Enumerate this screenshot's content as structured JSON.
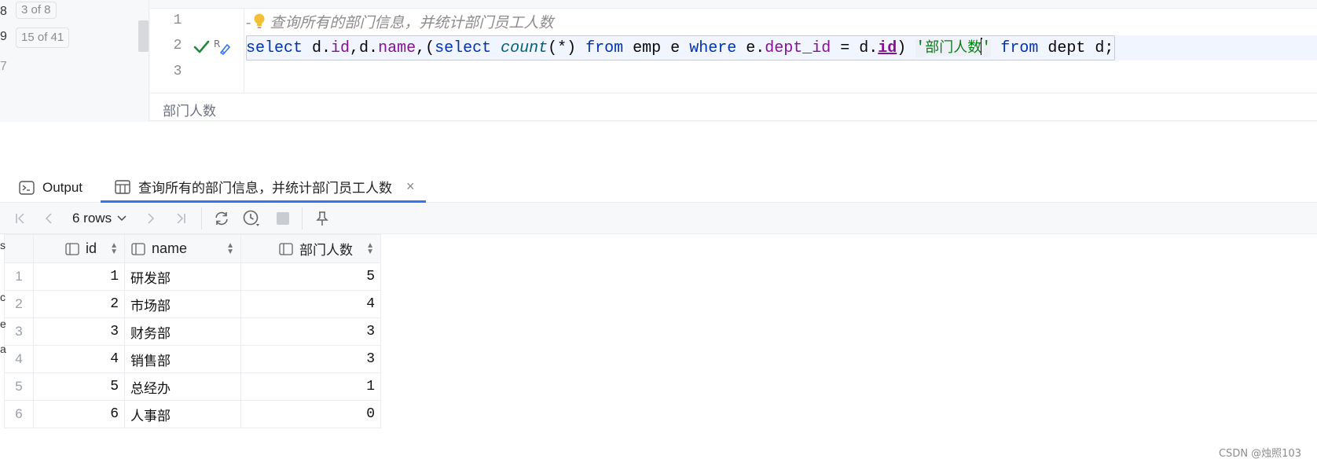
{
  "left_strip": {
    "row1_num": "8",
    "row1_badge": "3 of 8",
    "row2_num": "9",
    "row2_badge": "15 of 41",
    "row3_num": "7"
  },
  "editor": {
    "line_numbers": [
      "1",
      "2",
      "3"
    ],
    "line1_prefix": "-",
    "line1_comment": "查询所有的部门信息，并统计部门员工人数",
    "line2": {
      "t1": "select",
      "t2": " d.",
      "t3": "id",
      "t4": ",d.",
      "t5": "name",
      "t6": ",(",
      "t7": "select",
      "t8": " ",
      "t9": "count",
      "t10": "(*) ",
      "t11": "from",
      "t12": " emp e ",
      "t13": "where",
      "t14": " e.",
      "t15": "dept_id",
      "t16": " = d.",
      "t17": "id",
      "t18": ") ",
      "t19_quote_open": "'",
      "t20_str": "部门人数",
      "t21_quote_close": "'",
      "t22": " ",
      "t23": "from",
      "t24": " dept d;"
    },
    "hint": "部门人数"
  },
  "tabs": {
    "output_label": "Output",
    "result_label": "查询所有的部门信息，并统计部门员工人数",
    "close_icon": "×"
  },
  "toolbar": {
    "rows_label": "6 rows"
  },
  "grid": {
    "columns": [
      "id",
      "name",
      "部门人数"
    ],
    "rows": [
      {
        "rn": "1",
        "id": "1",
        "name": "研发部",
        "count": "5"
      },
      {
        "rn": "2",
        "id": "2",
        "name": "市场部",
        "count": "4"
      },
      {
        "rn": "3",
        "id": "3",
        "name": "财务部",
        "count": "3"
      },
      {
        "rn": "4",
        "id": "4",
        "name": "销售部",
        "count": "3"
      },
      {
        "rn": "5",
        "id": "5",
        "name": "总经办",
        "count": "1"
      },
      {
        "rn": "6",
        "id": "6",
        "name": "人事部",
        "count": "0"
      }
    ]
  },
  "left_clip": [
    "s",
    "c",
    "e",
    "a"
  ],
  "watermark": "CSDN @烛照103",
  "colors": {
    "keyword": "#0033b3",
    "field": "#871094",
    "function": "#00627a",
    "string": "#067d17",
    "comment": "#8c8c8c",
    "accent_tab": "#3574f0",
    "check": "#208a3c"
  }
}
